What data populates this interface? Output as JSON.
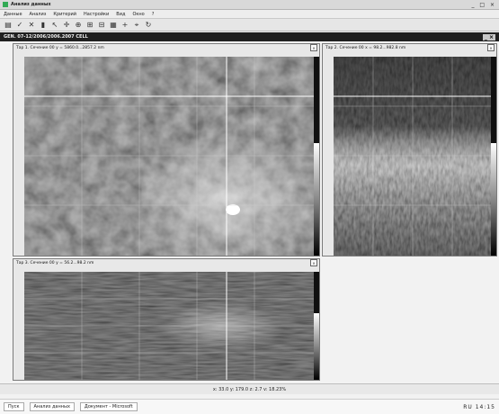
{
  "window": {
    "title": "Анализ данных",
    "controls": "_ □ ×"
  },
  "menu": [
    "Данные",
    "Анализ",
    "Критерий",
    "Настройки",
    "Вид",
    "Окно",
    "?"
  ],
  "toolbar_icons": [
    "open-icon",
    "check-icon",
    "x-icon",
    "bars-icon",
    "cursor-icon",
    "cross-icon",
    "zoom-icon",
    "zoom-in-icon",
    "zoom-out-icon",
    "grid-icon",
    "plus-icon",
    "filter-icon",
    "refresh-icon"
  ],
  "document": {
    "title": "GEN. 07-12/2006/2006.2007 CELL",
    "controls": "_ ×"
  },
  "panels": {
    "main": {
      "title": "Тар 1. Сечение 00 y = 5860.0...2857.2 nm"
    },
    "right": {
      "title": "Тар 2. Сечение 00 x = 98.2...982.8 nm"
    },
    "bottom": {
      "title": "Тар 3. Сечение 00 y = 56.2...98.2 nm"
    }
  },
  "status": {
    "text": "x: 33.0 y: 179.0 z: 2.7 v: 18.23%"
  },
  "taskbar": {
    "start": "Пуск",
    "items": [
      "Анализ данных",
      "Документ - Microsoft"
    ],
    "tray": "RU 14:15"
  }
}
